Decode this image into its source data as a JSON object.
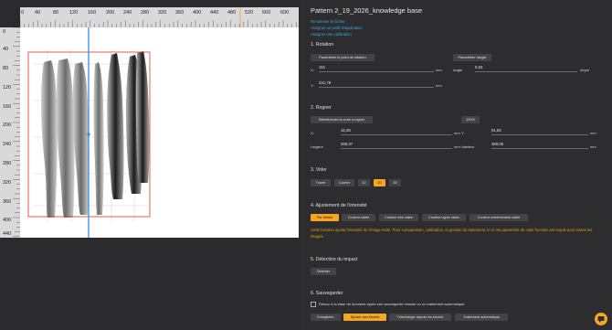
{
  "ruler": {
    "top_ticks": [
      "0",
      "40",
      "80",
      "120",
      "160",
      "200",
      "240",
      "280",
      "320",
      "360",
      "400",
      "440",
      "480",
      "520",
      "560",
      "600"
    ],
    "left_ticks": [
      "0",
      "40",
      "80",
      "120",
      "160",
      "200",
      "240",
      "280",
      "320",
      "360",
      "400",
      "440"
    ]
  },
  "title": "Pattern 2_19_2026_knowledge base",
  "links": [
    "Renommer le fichier",
    "Assigner un profil d'application",
    "Assigner une calibration"
  ],
  "rotation": {
    "heading": "1. Rotation",
    "btn_point": "Paramêtrer le point de rotation",
    "btn_angle": "Paramêtrer l'angle",
    "x_label": "X:",
    "x_value": "151",
    "x_unit": "mm",
    "y_label": "Y:",
    "y_value": "231,78",
    "y_unit": "mm",
    "angle_label": "Angle",
    "angle_value": "0,63",
    "angle_unit": "degré"
  },
  "crop": {
    "heading": "2. Rogner",
    "btn_select": "Sélectionnez la zone à rogner",
    "btn_pct": "100%",
    "x_label": "X:",
    "x_value": "16,38",
    "x_unit": "mm",
    "y_label": "Y:",
    "y_value": "51,82",
    "y_unit": "mm",
    "w_label": "Largeur",
    "w_value": "269,37",
    "w_unit": "mm",
    "h_label": "Hauteur",
    "h_value": "360,05",
    "h_unit": "mm"
  },
  "empty": {
    "heading": "3. Vider",
    "buttons": [
      "Tracer",
      "Cacher",
      "10",
      "20",
      "30"
    ]
  },
  "intensity": {
    "heading": "4. Ajustement de l'intensité",
    "buttons": [
      "Par défaut",
      "Couleur claire",
      "Couleur très claire",
      "Couleur hyper claire",
      "Couleur extrêmement claire"
    ],
    "note": "Cette fonction ajuste l'intensité de l'image traité. Pour comparaison, calibration, et gestion du traitement, le m   me paramètre de cette fonction est requis pour toutes les images."
  },
  "detect": {
    "heading": "5. Détection du impact",
    "button": "Détecter"
  },
  "save": {
    "heading": "6. Sauvegarder",
    "checkbox_label": "Retour à la base de données après une sauvegarde réussie ou un traitement automatique",
    "buttons": [
      "Enregistrer",
      "Ajouter aux favoris",
      "Télécharger depuis les favoris",
      "Traitement automatique"
    ]
  },
  "colors": {
    "accent": "#f5a623",
    "link": "#3ba7e6",
    "crop_frame": "#e0302a",
    "guide_line": "#1e88e5"
  }
}
